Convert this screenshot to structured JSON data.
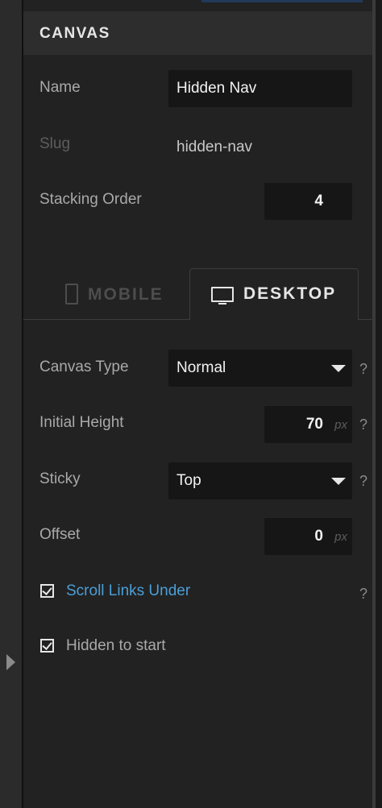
{
  "panel": {
    "title": "CANVAS"
  },
  "fields": {
    "name_label": "Name",
    "name_value": "Hidden Nav",
    "slug_label": "Slug",
    "slug_value": "hidden-nav",
    "stacking_label": "Stacking Order",
    "stacking_value": "4"
  },
  "tabs": [
    {
      "label": "MOBILE",
      "icon": "phone-icon",
      "active": false
    },
    {
      "label": "DESKTOP",
      "icon": "monitor-icon",
      "active": true
    }
  ],
  "desktop": {
    "canvas_type_label": "Canvas Type",
    "canvas_type_value": "Normal",
    "initial_height_label": "Initial Height",
    "initial_height_value": "70",
    "initial_height_unit": "px",
    "sticky_label": "Sticky",
    "sticky_value": "Top",
    "offset_label": "Offset",
    "offset_value": "0",
    "offset_unit": "px",
    "help_symbol": "?",
    "scroll_links_label": "Scroll Links Under",
    "scroll_links_checked": true,
    "hidden_start_label": "Hidden to start",
    "hidden_start_checked": true
  },
  "colors": {
    "accent_link": "#4a9fd8",
    "panel_bg": "#222222",
    "field_bg": "#161616"
  }
}
